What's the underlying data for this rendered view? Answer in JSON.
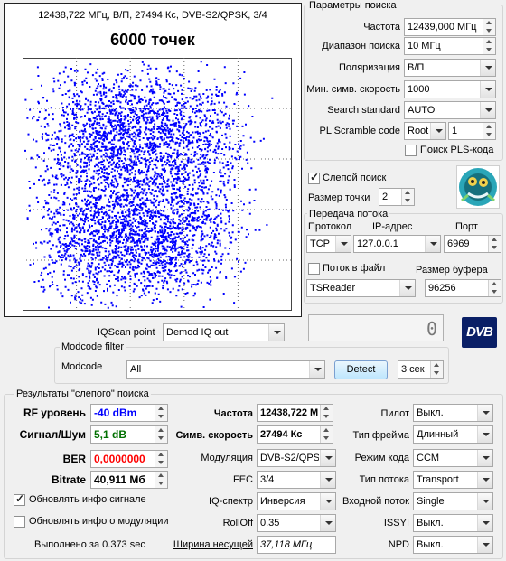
{
  "constellation": {
    "header": "12438,722 МГц, В/П, 27494 Кс, DVB-S2/QPSK, 3/4",
    "points_label": "6000 точек",
    "point_color": "#0000ff"
  },
  "search_params": {
    "title": "Параметры поиска",
    "frequency_label": "Частота",
    "frequency_value": "12439,000 МГц",
    "range_label": "Диапазон поиска",
    "range_value": "10 МГц",
    "polarization_label": "Поляризация",
    "polarization_value": "В/П",
    "min_sr_label": "Мин. симв. скорость",
    "min_sr_value": "1000",
    "standard_label": "Search standard",
    "standard_value": "AUTO",
    "pl_label": "PL Scramble code",
    "pl_mode_value": "Root",
    "pl_code_value": "1",
    "pls_search_label": "Поиск PLS-кода"
  },
  "blind": {
    "blind_search_label": "Слепой поиск",
    "point_size_label": "Размер точки",
    "point_size_value": "2"
  },
  "stream": {
    "title": "Передача потока",
    "protocol_label": "Протокол",
    "ip_label": "IP-адрес",
    "port_label": "Порт",
    "protocol_value": "TCP",
    "ip_value": "127.0.0.1",
    "port_value": "6969",
    "to_file_label": "Поток в файл",
    "buffer_label": "Размер буфера",
    "app_value": "TSReader",
    "buffer_value": "96256"
  },
  "iq": {
    "point_label": "IQScan point",
    "point_value": "Demod IQ out",
    "counter_value": "0",
    "logo_text": "DVB"
  },
  "modcode": {
    "title": "Modcode filter",
    "label": "Modcode",
    "value": "All",
    "detect_label": "Detect",
    "seconds_value": "3 сек"
  },
  "results": {
    "title": "Результаты \"слепого\" поиска",
    "rf_label": "RF уровень",
    "rf_value": "-40 dBm",
    "snr_label": "Сигнал/Шум",
    "snr_value": "5,1 dB",
    "ber_label": "BER",
    "ber_value": "0,0000000",
    "bitrate_label": "Bitrate",
    "bitrate_value": "40,911 Мб",
    "update_signal_label": "Обновлять инфо сигнале",
    "update_mod_label": "Обновлять инфо о модуляции",
    "done_label": "Выполнено за 0.373 sec",
    "freq_label": "Частота",
    "freq_value": "12438,722 М",
    "sr_label": "Симв. скорость",
    "sr_value": "27494 Кс",
    "modulation_label": "Модуляция",
    "modulation_value": "DVB-S2/QPSK",
    "fec_label": "FEC",
    "fec_value": "3/4",
    "iq_label": "IQ-спектр",
    "iq_value": "Инверсия",
    "rolloff_label": "RollOff",
    "rolloff_value": "0.35",
    "bw_label": "Ширина несущей",
    "bw_value": "37,118 МГц",
    "pilot_label": "Пилот",
    "pilot_value": "Выкл.",
    "frame_label": "Тип фрейма",
    "frame_value": "Длинный",
    "codemode_label": "Режим кода",
    "codemode_value": "CCM",
    "streamtype_label": "Тип потока",
    "streamtype_value": "Transport",
    "input_label": "Входной поток",
    "input_value": "Single",
    "issyi_label": "ISSYI",
    "issyi_value": "Выкл.",
    "npd_label": "NPD",
    "npd_value": "Выкл.",
    "rf_color": "#0000ff",
    "snr_color": "#007000",
    "ber_color": "#ff0000"
  }
}
